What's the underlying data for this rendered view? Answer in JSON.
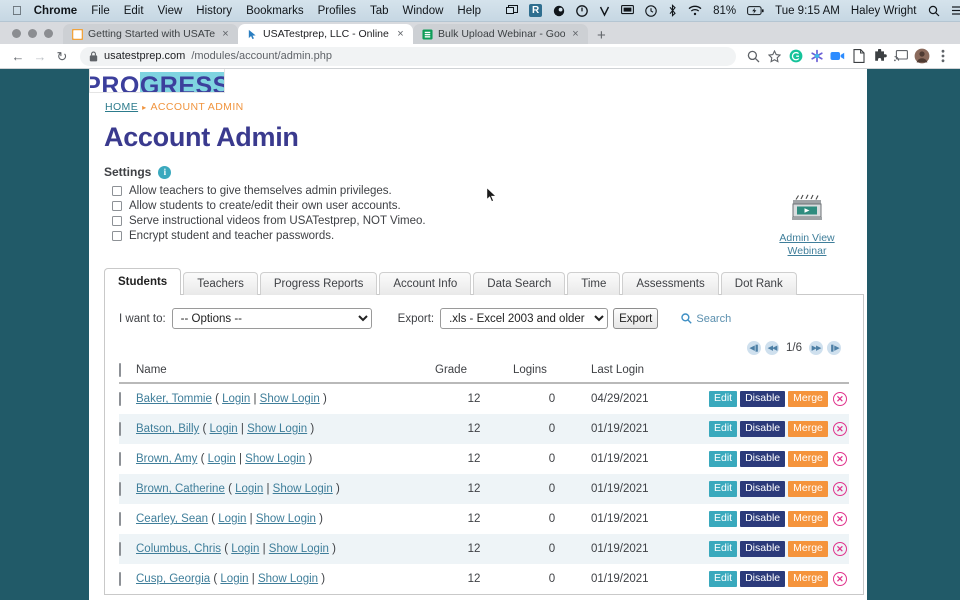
{
  "menubar": {
    "apple": "apple-logo",
    "items": [
      "Chrome",
      "File",
      "Edit",
      "View",
      "History",
      "Bookmarks",
      "Profiles",
      "Tab",
      "Window",
      "Help"
    ],
    "battery": "81%",
    "clock": "Tue 9:15 AM",
    "user": "Haley Wright",
    "status_icons": [
      "screen-mirroring-icon",
      "r-box-icon",
      "circle-icon",
      "power-circle-icon",
      "v-icon",
      "display-icon",
      "clock-icon",
      "bluetooth-icon",
      "wifi-icon",
      "battery-icon",
      "search-icon",
      "control-center-icon"
    ]
  },
  "browser": {
    "tabs": [
      {
        "title": "Getting Started with USATestp",
        "favicon": "orange-square-favicon",
        "active": false
      },
      {
        "title": "USATestprep, LLC - Online Sta",
        "favicon": "cursor-favicon",
        "active": true
      },
      {
        "title": "Bulk Upload Webinar - Google",
        "favicon": "green-sheets-favicon",
        "active": false
      }
    ],
    "newtab_label": "+",
    "close_label": "×",
    "back_label": "←",
    "forward_label": "→",
    "reload_label": "↻",
    "lock_icon": "lock-icon",
    "url_host": "usatestprep.com",
    "url_path": "/modules/account/admin.php",
    "toolbar_icons": [
      "zoom-icon",
      "bookmark-star-icon",
      "grammarly-icon",
      "extension-asterisk-icon",
      "video-camera-icon",
      "document-icon",
      "puzzle-piece-icon",
      "cast-icon",
      "profile-avatar-icon",
      "three-dot-menu-icon"
    ]
  },
  "page": {
    "logo_text_pre": "PRO",
    "logo_text_hl": "GRESS",
    "breadcrumb": {
      "home": "HOME",
      "separator": "▸",
      "current": "ACCOUNT ADMIN"
    },
    "title": "Account Admin",
    "settings": {
      "label": "Settings",
      "info_glyph": "i",
      "options": [
        "Allow teachers to give themselves admin privileges.",
        "Allow students to create/edit their own user accounts.",
        "Serve instructional videos from USATestprep, NOT Vimeo.",
        "Encrypt student and teacher passwords."
      ]
    },
    "webinar": {
      "icon": "film-clapperboard-play-icon",
      "line1": "Admin View",
      "line2": "Webinar"
    },
    "tabs": [
      {
        "label": "Students",
        "active": true
      },
      {
        "label": "Teachers",
        "active": false
      },
      {
        "label": "Progress Reports",
        "active": false
      },
      {
        "label": "Account Info",
        "active": false
      },
      {
        "label": "Data Search",
        "active": false
      },
      {
        "label": "Time",
        "active": false
      },
      {
        "label": "Assessments",
        "active": false
      },
      {
        "label": "Dot Rank",
        "active": false
      }
    ],
    "controls": {
      "want_to_label": "I want to:",
      "want_to_value": "-- Options --",
      "export_label": "Export:",
      "export_value": ".xls - Excel 2003 and older",
      "export_button": "Export",
      "search_label": "Search",
      "search_icon": "magnifier-icon"
    },
    "pager": {
      "first": "◀❚",
      "prev": "◀◀",
      "value": "1/6",
      "next": "▶▶",
      "last": "❚▶"
    },
    "table": {
      "columns": [
        "Name",
        "Grade",
        "Logins",
        "Last Login"
      ],
      "login_label": "Login",
      "show_login_label": "Show Login",
      "open_paren": "(",
      "pipe": "|",
      "close_paren": ")",
      "actions": {
        "edit": "Edit",
        "disable": "Disable",
        "merge": "Merge",
        "delete": "✕"
      },
      "rows": [
        {
          "name": "Baker, Tommie",
          "grade": "12",
          "logins": "0",
          "last_login": "04/29/2021"
        },
        {
          "name": "Batson, Billy",
          "grade": "12",
          "logins": "0",
          "last_login": "01/19/2021"
        },
        {
          "name": "Brown, Amy",
          "grade": "12",
          "logins": "0",
          "last_login": "01/19/2021"
        },
        {
          "name": "Brown, Catherine",
          "grade": "12",
          "logins": "0",
          "last_login": "01/19/2021"
        },
        {
          "name": "Cearley, Sean",
          "grade": "12",
          "logins": "0",
          "last_login": "01/19/2021"
        },
        {
          "name": "Columbus, Chris",
          "grade": "12",
          "logins": "0",
          "last_login": "01/19/2021"
        },
        {
          "name": "Cusp, Georgia",
          "grade": "12",
          "logins": "0",
          "last_login": "01/19/2021"
        }
      ]
    }
  }
}
